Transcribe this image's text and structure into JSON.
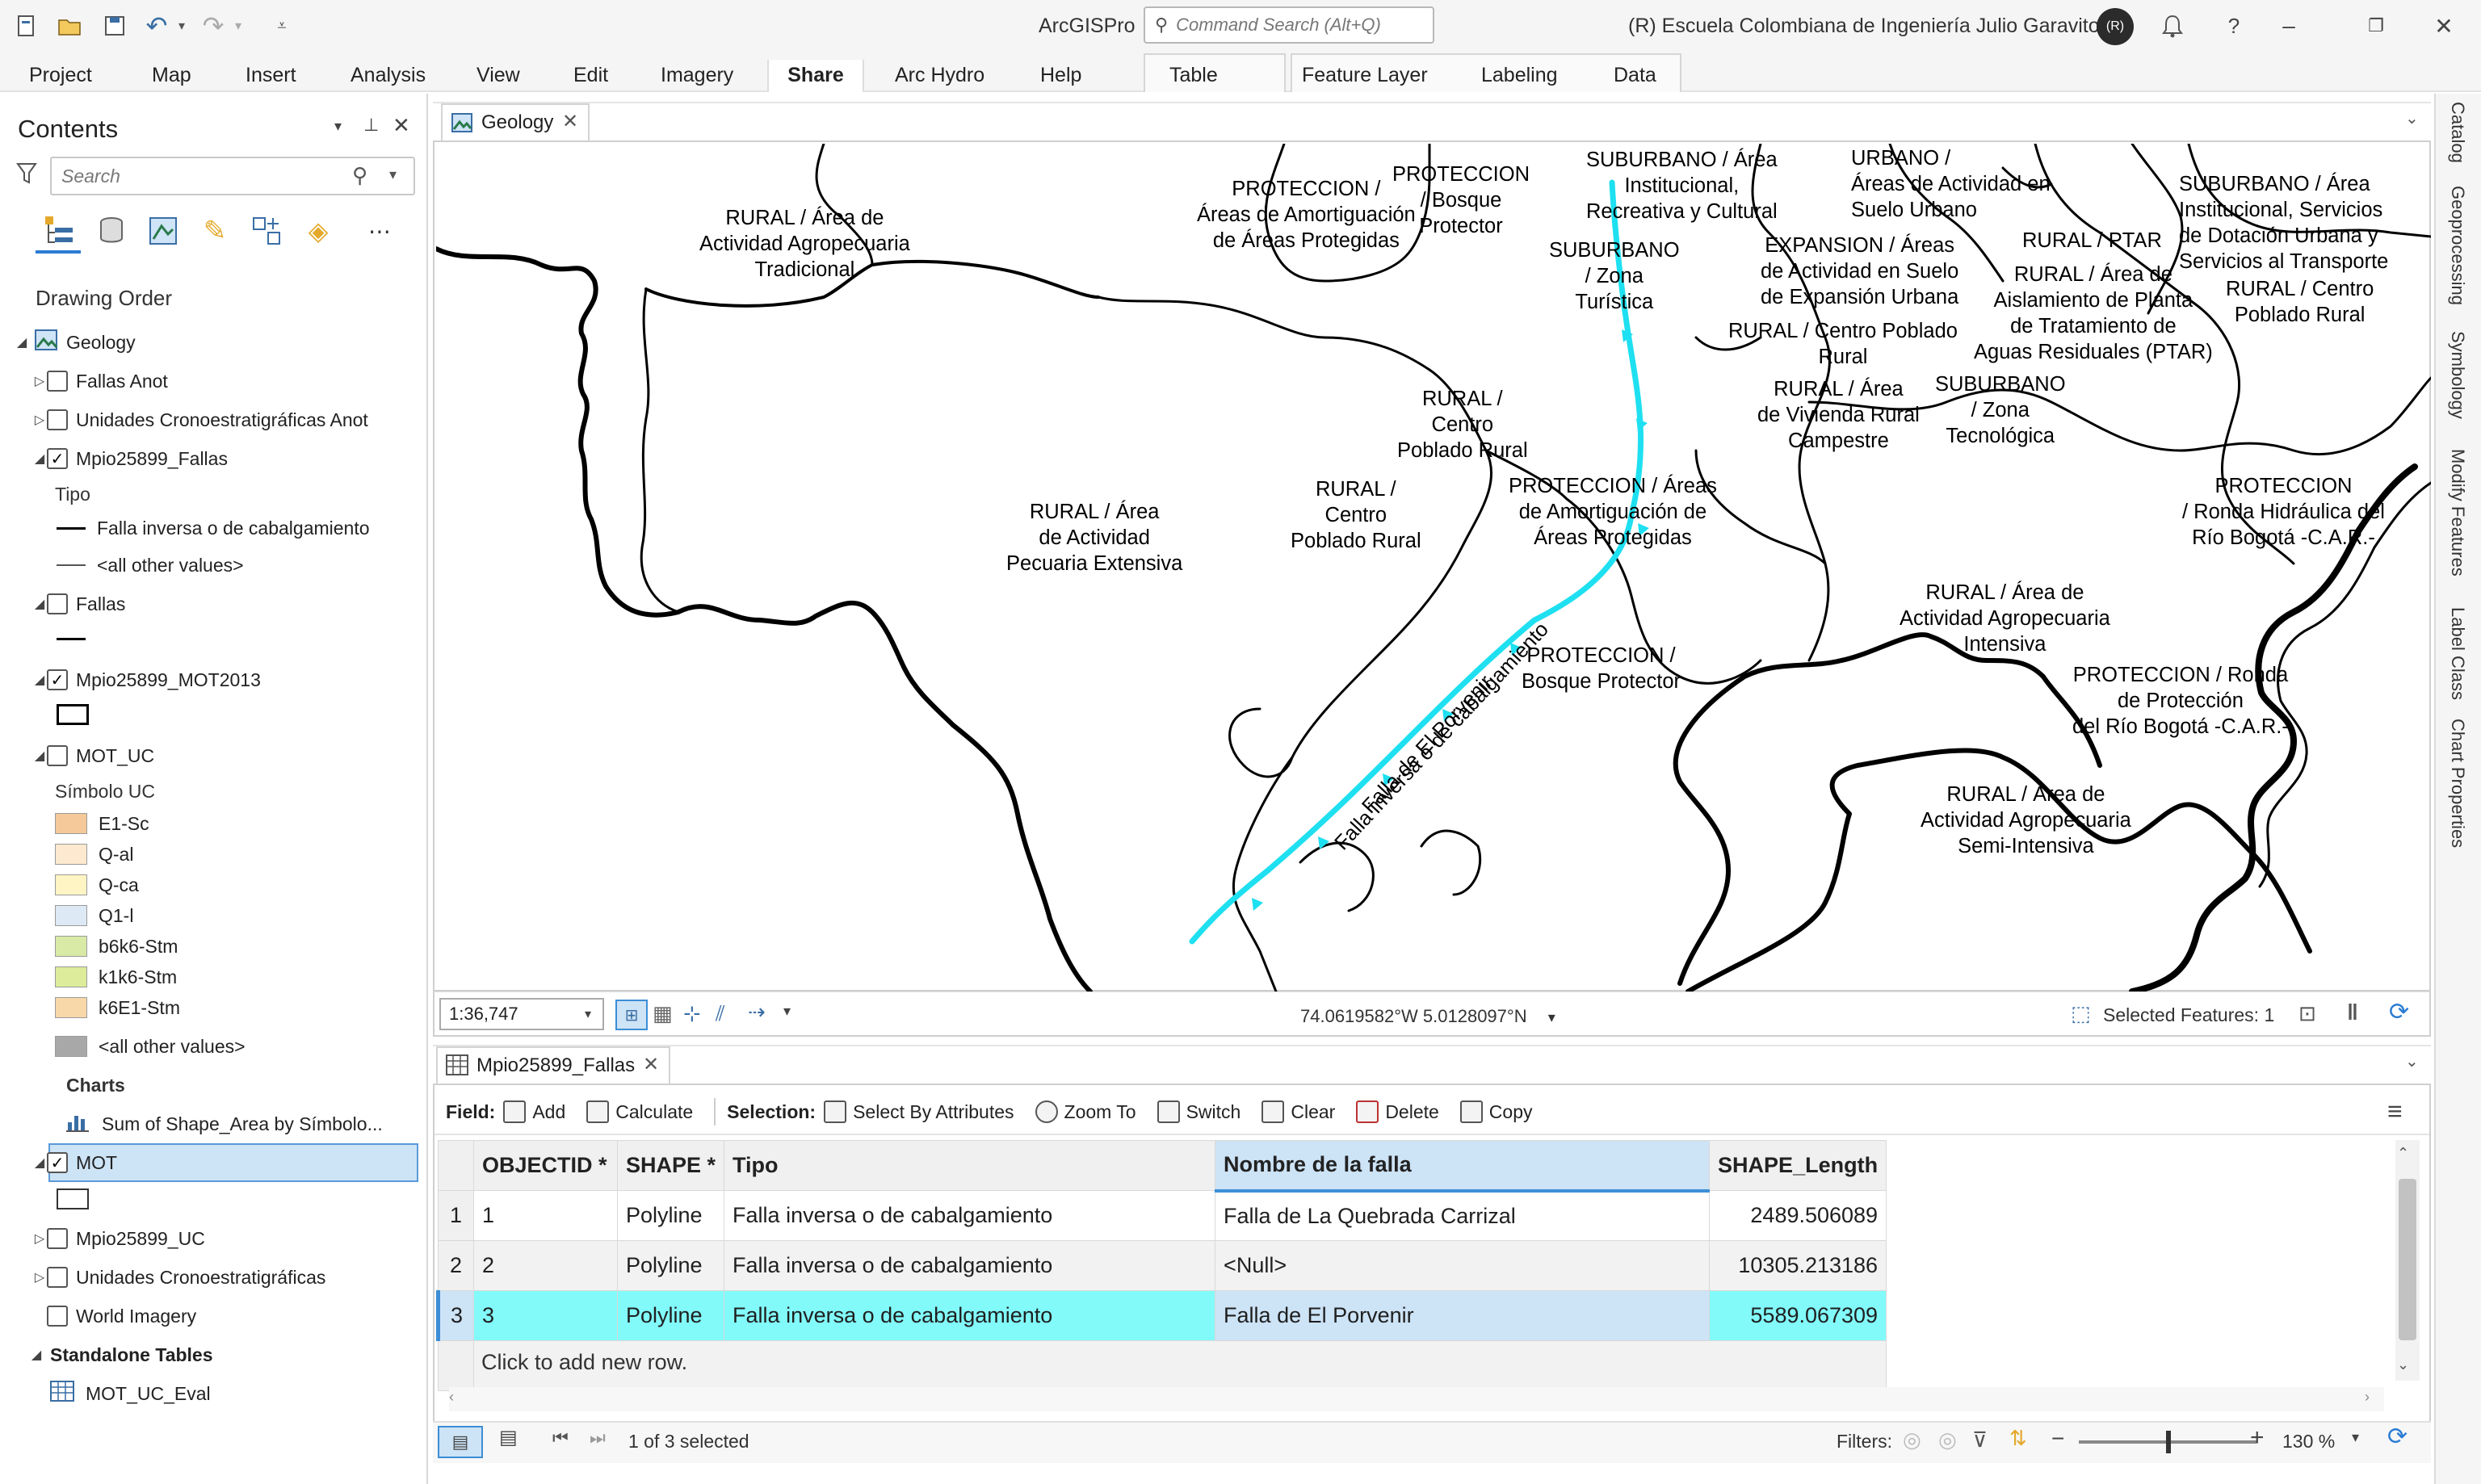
{
  "app": {
    "title": "ArcGISPro",
    "org": "(R)  Escuela Colombiana de Ingeniería Julio Garavito",
    "avatar_initials": "(R)"
  },
  "command_search": {
    "placeholder": "Command Search (Alt+Q)"
  },
  "ribbon": {
    "tabs": [
      "Project",
      "Map",
      "Insert",
      "Analysis",
      "View",
      "Edit",
      "Imagery",
      "Share",
      "Arc Hydro",
      "Help"
    ],
    "active_tab": "Share",
    "context_tabs": {
      "table_group": [
        "Table"
      ],
      "layer_group": [
        "Feature Layer",
        "Labeling",
        "Data"
      ]
    }
  },
  "contents": {
    "title": "Contents",
    "search_placeholder": "Search",
    "drawing_order_label": "Drawing Order",
    "map_name": "Geology",
    "layers": [
      {
        "name": "Fallas Anot",
        "checked": false
      },
      {
        "name": "Unidades Cronoestratigráficas Anot",
        "checked": false
      },
      {
        "name": "Mpio25899_Fallas",
        "checked": true,
        "field": "Tipo",
        "legend": [
          "Falla inversa o de cabalgamiento",
          "<all other values>"
        ]
      },
      {
        "name": "Fallas",
        "checked": false
      },
      {
        "name": "Mpio25899_MOT2013",
        "checked": true
      },
      {
        "name": "MOT_UC",
        "checked": false,
        "field": "Símbolo UC",
        "legend": [
          {
            "label": "E1-Sc",
            "color": "#f5c99a"
          },
          {
            "label": "Q-al",
            "color": "#fde9cf"
          },
          {
            "label": "Q-ca",
            "color": "#fff4c4"
          },
          {
            "label": "Q1-l",
            "color": "#dde9f4"
          },
          {
            "label": "b6k6-Stm",
            "color": "#d9e9a6"
          },
          {
            "label": "k1k6-Stm",
            "color": "#dcec9a"
          },
          {
            "label": "k6E1-Stm",
            "color": "#f8d7a8"
          },
          {
            "label": "<all other values>",
            "color": "#a8a8a8"
          }
        ],
        "charts_label": "Charts",
        "chart_item": "Sum of Shape_Area by Símbolo..."
      },
      {
        "name": "MOT",
        "checked": true,
        "selected": true
      },
      {
        "name": "Mpio25899_UC",
        "checked": false
      },
      {
        "name": "Unidades Cronoestratigráficas",
        "checked": false
      },
      {
        "name": "World Imagery",
        "checked": false
      }
    ],
    "standalone_tables_label": "Standalone Tables",
    "standalone_tables": [
      "MOT_UC_Eval"
    ]
  },
  "map": {
    "tab_label": "Geology",
    "scale": "1:36,747",
    "coordinates": "74.0619582°W 5.0128097°N",
    "selected_features": "Selected Features: 1",
    "labels": [
      "RURAL / Área de\nActividad Agropecuaria\nTradicional",
      "PROTECCION /\nÁreas de Amortiguación\nde Áreas Protegidas",
      "PROTECCION\n/ Bosque\nProtector",
      "SUBURBANO / Área\nInstitucional,\nRecreativa y Cultural",
      "URBANO /\nÁreas de Actividad en\nSuelo Urbano",
      "SUBURBANO / Área\nInstitucional, Servicios\nde Dotación Urbana y\nServicios al Transporte",
      "SUBURBANO\n/ Zona\nTurística",
      "EXPANSION / Áreas\nde Actividad en Suelo\nde Expansión Urbana",
      "RURAL / PTAR",
      "RURAL / Área de\nAislamiento de Planta\nde Tratamiento de\nAguas Residuales (PTAR)",
      "RURAL / Centro\nPoblado Rural",
      "RURAL / Centro Poblado\nRural",
      "RURAL / Área\nde Vivienda Rural\nCampestre",
      "SUBURBANO\n/ Zona\nTecnológica",
      "RURAL /\nCentro\nPoblado Rural",
      "RURAL /\nCentro\nPoblado Rural",
      "RURAL / Área\nde Actividad\nPecuaria Extensiva",
      "PROTECCION / Áreas\nde Amortiguación de\nÁreas Protegidas",
      "PROTECCION\n/ Ronda Hidráulica del\nRío Bogotá -C.A.R.-",
      "RURAL / Área de\nActividad Agropecuaria\nIntensiva",
      "PROTECCION /\nBosque Protector",
      "PROTECCION / Ronda\nde Protección\ndel Río Bogotá -C.A.R.-",
      "RURAL / Área de\nActividad Agropecuaria\nSemi-Intensiva",
      "Falla inversa o de cabalgamiento",
      "Falla de El Porvenir"
    ]
  },
  "right_panes": [
    "Catalog",
    "Geoprocessing",
    "Symbology",
    "Modify Features",
    "Label Class",
    "Chart Properties"
  ],
  "attribute_table": {
    "tab_label": "Mpio25899_Fallas",
    "toolbar": {
      "field_label": "Field:",
      "add": "Add",
      "calculate": "Calculate",
      "selection_label": "Selection:",
      "select_by_attributes": "Select By Attributes",
      "zoom_to": "Zoom To",
      "switch": "Switch",
      "clear": "Clear",
      "delete": "Delete",
      "copy": "Copy"
    },
    "columns": [
      "OBJECTID *",
      "SHAPE *",
      "Tipo",
      "Nombre de la falla",
      "SHAPE_Length"
    ],
    "rows": [
      {
        "n": "1",
        "objectid": "1",
        "shape": "Polyline",
        "tipo": "Falla inversa o de cabalgamiento",
        "nombre": "Falla de La Quebrada Carrizal",
        "length": "2489.506089"
      },
      {
        "n": "2",
        "objectid": "2",
        "shape": "Polyline",
        "tipo": "Falla inversa o de cabalgamiento",
        "nombre": "<Null>",
        "length": "10305.213186"
      },
      {
        "n": "3",
        "objectid": "3",
        "shape": "Polyline",
        "tipo": "Falla inversa o de cabalgamiento",
        "nombre": "Falla de El Porvenir",
        "length": "5589.067309"
      }
    ],
    "add_row_text": "Click to add new row.",
    "selection_status": "1 of 3 selected",
    "filters_label": "Filters:",
    "zoom": "130 %"
  }
}
